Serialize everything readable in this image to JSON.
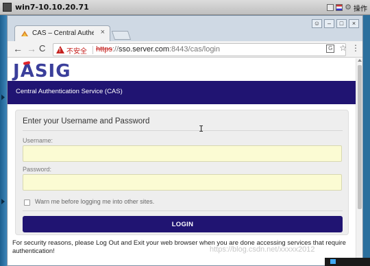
{
  "vm": {
    "title": "win7-10.10.20.71",
    "operate_label": "操作",
    "tool_icons": [
      "monitor-icon",
      "flag-icon",
      "gear-icon"
    ]
  },
  "browser": {
    "tab_title": "CAS – Central Authentic",
    "tab_close": "×",
    "window_buttons": [
      "user-icon",
      "minimize-icon",
      "restore-icon",
      "close-icon"
    ],
    "nav": {
      "back": "←",
      "forward": "→",
      "reload": "C"
    },
    "address": {
      "insecure_label": "不安全",
      "url_scheme": "https",
      "url_sep": "://",
      "url_host": "sso.server.com",
      "url_rest": ":8443/cas/login"
    },
    "toolbar_icons": [
      "translate-icon",
      "star-icon",
      "menu-icon"
    ],
    "translate_glyph": "G",
    "star_glyph": "☆",
    "menu_glyph": "⋮"
  },
  "page": {
    "logo_text_1": "J",
    "logo_text_2": "A",
    "logo_text_3": "SIG",
    "banner": "Central Authentication Service (CAS)",
    "form": {
      "heading": "Enter your Username and Password",
      "username_label": "Username:",
      "username_value": "",
      "password_label": "Password:",
      "password_value": "",
      "warn_label": "Warn me before logging me into other sites.",
      "warn_checked": false,
      "login_button": "LOGIN"
    },
    "security_note": "For security reasons, please Log Out and Exit your web browser when you are done accessing services that require authentication!"
  },
  "overlay": {
    "watermark": "https://blog.csdn.net/xxxxx2012"
  },
  "colors": {
    "cas_blue": "#201472",
    "input_yellow": "#fbfbd3",
    "insecure_red": "#c5221f",
    "logo_blue": "#3b3f9b",
    "logo_red": "#e0242a"
  }
}
